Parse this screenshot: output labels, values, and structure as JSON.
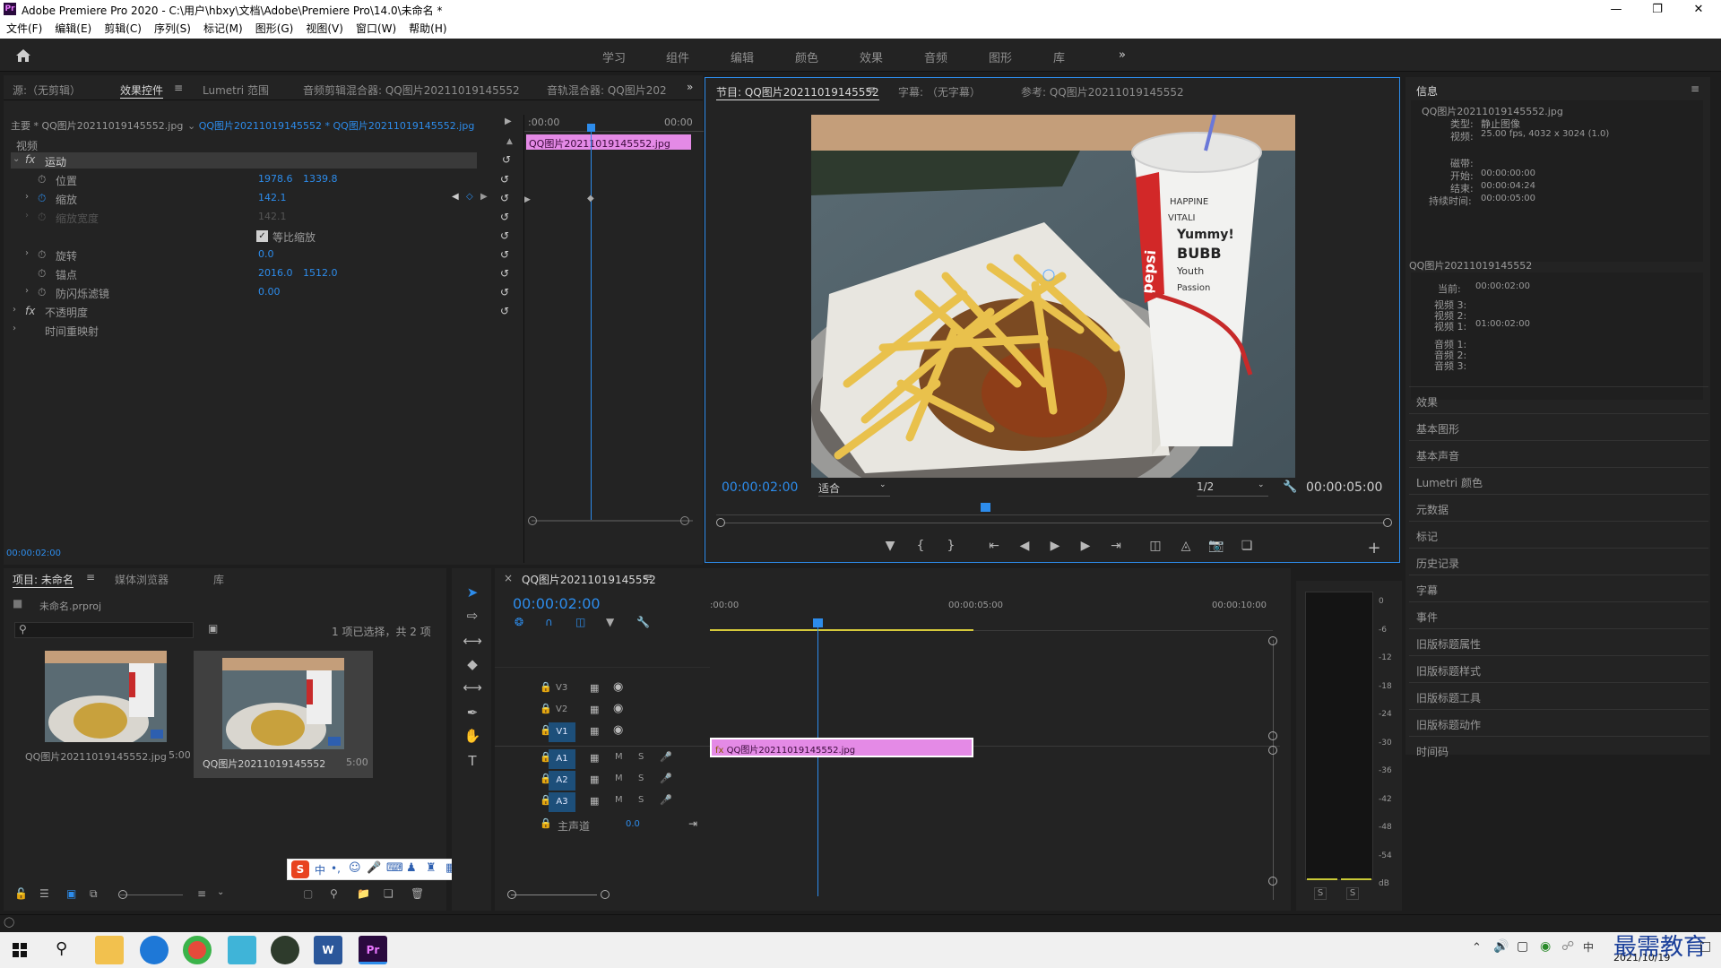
{
  "titlebar": {
    "title": "Adobe Premiere Pro 2020 - C:\\用户\\hbxy\\文档\\Adobe\\Premiere Pro\\14.0\\未命名 *"
  },
  "menu": [
    "文件(F)",
    "编辑(E)",
    "剪辑(C)",
    "序列(S)",
    "标记(M)",
    "图形(G)",
    "视图(V)",
    "窗口(W)",
    "帮助(H)"
  ],
  "workspaces": [
    "学习",
    "组件",
    "编辑",
    "颜色",
    "效果",
    "音频",
    "图形",
    "库"
  ],
  "source_panel": {
    "tabs": [
      "源:（无剪辑）",
      "效果控件",
      "Lumetri 范围",
      "音频剪辑混合器: QQ图片20211019145552",
      "音轨混合器: QQ图片202"
    ],
    "master": "主要 * QQ图片20211019145552.jpg",
    "sequence": "QQ图片20211019145552 * QQ图片20211019145552.jpg",
    "timecode_left": ":00:00",
    "timecode_right": "00:00",
    "clip_label": "QQ图片20211019145552.jpg",
    "section_video": "视频",
    "motion": "运动",
    "props": [
      {
        "name": "位置",
        "v1": "1978.6",
        "v2": "1339.8"
      },
      {
        "name": "缩放",
        "v1": "142.1",
        "v2": ""
      },
      {
        "name": "缩放宽度",
        "v1": "142.1",
        "v2": ""
      },
      {
        "name": "等比缩放",
        "v1": "",
        "v2": ""
      },
      {
        "name": "旋转",
        "v1": "0.0",
        "v2": ""
      },
      {
        "name": "锚点",
        "v1": "2016.0",
        "v2": "1512.0"
      },
      {
        "name": "防闪烁滤镜",
        "v1": "0.00",
        "v2": ""
      }
    ],
    "opacity": "不透明度",
    "timeremap": "时间重映射",
    "bottom_tc": "00:00:02:00"
  },
  "program": {
    "tabs": [
      "节目: QQ图片20211019145552",
      "字幕: （无字幕）",
      "参考: QQ图片20211019145552"
    ],
    "current_tc": "00:00:02:00",
    "fit": "适合",
    "res": "1/2",
    "end_tc": "00:00:05:00",
    "cup_text": [
      "HAPPINE",
      "VITALI",
      "Yummy!",
      "BUBB",
      "Youth",
      "Passion"
    ],
    "cup_brand": "pepsi"
  },
  "info": {
    "title": "信息",
    "file": "QQ图片20211019145552.jpg",
    "lines": [
      {
        "k": "类型:",
        "v": "静止图像"
      },
      {
        "k": "视频:",
        "v": "25.00 fps, 4032 x 3024 (1.0)"
      },
      {
        "k": "磁带:",
        "v": ""
      },
      {
        "k": "开始:",
        "v": "00:00:00:00"
      },
      {
        "k": "结束:",
        "v": "00:00:04:24"
      },
      {
        "k": "持续时间:",
        "v": "00:00:05:00"
      }
    ],
    "seq_name": "QQ图片20211019145552",
    "seq_lines": [
      {
        "k": "当前:",
        "v": "00:00:02:00"
      },
      {
        "k": "视频 3:",
        "v": ""
      },
      {
        "k": "视频 2:",
        "v": ""
      },
      {
        "k": "视频 1:",
        "v": "01:00:02:00"
      },
      {
        "k": "音频 1:",
        "v": ""
      },
      {
        "k": "音频 2:",
        "v": ""
      },
      {
        "k": "音频 3:",
        "v": ""
      }
    ],
    "panels": [
      "效果",
      "基本图形",
      "基本声音",
      "Lumetri 颜色",
      "元数据",
      "标记",
      "历史记录",
      "字幕",
      "事件",
      "旧版标题属性",
      "旧版标题样式",
      "旧版标题工具",
      "旧版标题动作",
      "时间码"
    ]
  },
  "project": {
    "tabs": [
      "项目: 未命名",
      "媒体浏览器",
      "库"
    ],
    "file": "未命名.prproj",
    "status": "1 项已选择，共 2 项",
    "items": [
      {
        "name": "QQ图片20211019145552.jpg",
        "dur": "5:00"
      },
      {
        "name": "QQ图片20211019145552",
        "dur": "5:00"
      }
    ]
  },
  "timeline": {
    "tab": "QQ图片20211019145552",
    "tc": "00:00:02:00",
    "ruler": [
      ":00:00",
      "00:00:05:00",
      "00:00:10:00"
    ],
    "video_tracks": [
      "V3",
      "V2",
      "V1"
    ],
    "audio_tracks": [
      "A1",
      "A2",
      "A3"
    ],
    "master": "主声道",
    "master_val": "0.0",
    "clip": "QQ图片20211019145552.jpg"
  },
  "meter": {
    "scale": [
      "0",
      "-6",
      "-12",
      "-18",
      "-24",
      "-30",
      "-36",
      "-42",
      "-48",
      "-54",
      "dB"
    ],
    "solo": [
      "S",
      "S"
    ]
  },
  "taskbar": {
    "date": "2021/10/19",
    "watermark": "最需教育",
    "ime": "中"
  }
}
